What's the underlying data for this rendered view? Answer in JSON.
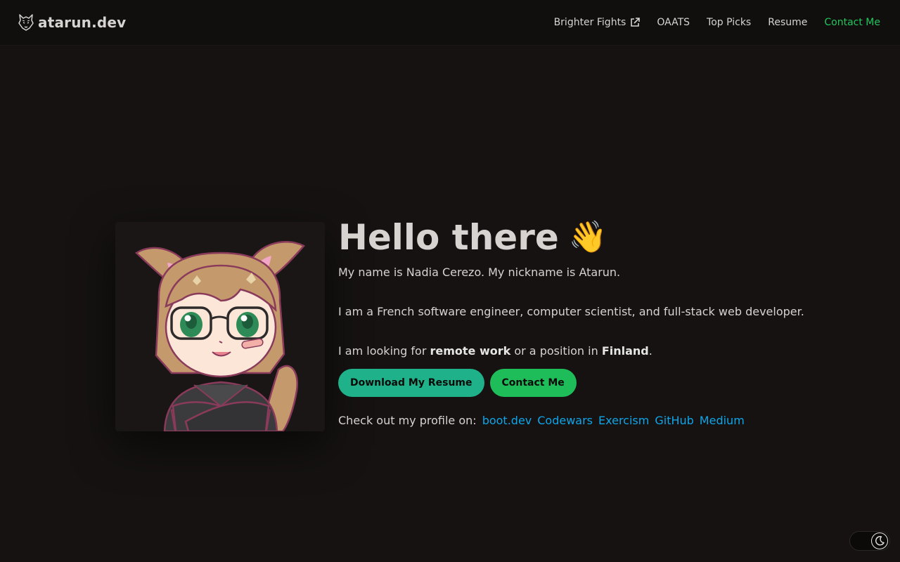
{
  "brand": {
    "name": "atarun.dev",
    "logo_icon": "wolf-icon"
  },
  "nav": {
    "links": [
      {
        "label": "Brighter Fights",
        "icon": "external-link-icon"
      },
      {
        "label": "OAATS"
      },
      {
        "label": "Top Picks"
      },
      {
        "label": "Resume"
      },
      {
        "label": "Contact Me",
        "accent": "#22c55e"
      }
    ]
  },
  "hero": {
    "avatar": "anime-style-character-illustration",
    "title": "Hello there",
    "title_emoji": "👋",
    "intro": "My name is Nadia Cerezo. My nickname is Atarun.",
    "role": "I am a French software engineer, computer scientist, and full-stack web developer.",
    "looking_prefix": "I am looking for ",
    "looking_bold1": "remote work",
    "looking_middle": " or a position in ",
    "looking_bold2": "Finland",
    "looking_suffix": ".",
    "buttons": {
      "resume": "Download My Resume",
      "contact": "Contact Me"
    },
    "profiles_label": "Check out my profile on:",
    "profiles": [
      "boot.dev",
      "Codewars",
      "Exercism",
      "GitHub",
      "Medium"
    ]
  },
  "theme_toggle": {
    "icon": "moon-icon",
    "state": "dark"
  },
  "colors": {
    "background": "#151211",
    "accent_green": "#22c55e",
    "link_blue": "#0ea5e9",
    "button_teal": "#1fb28a",
    "button_green": "#1fbd59"
  }
}
